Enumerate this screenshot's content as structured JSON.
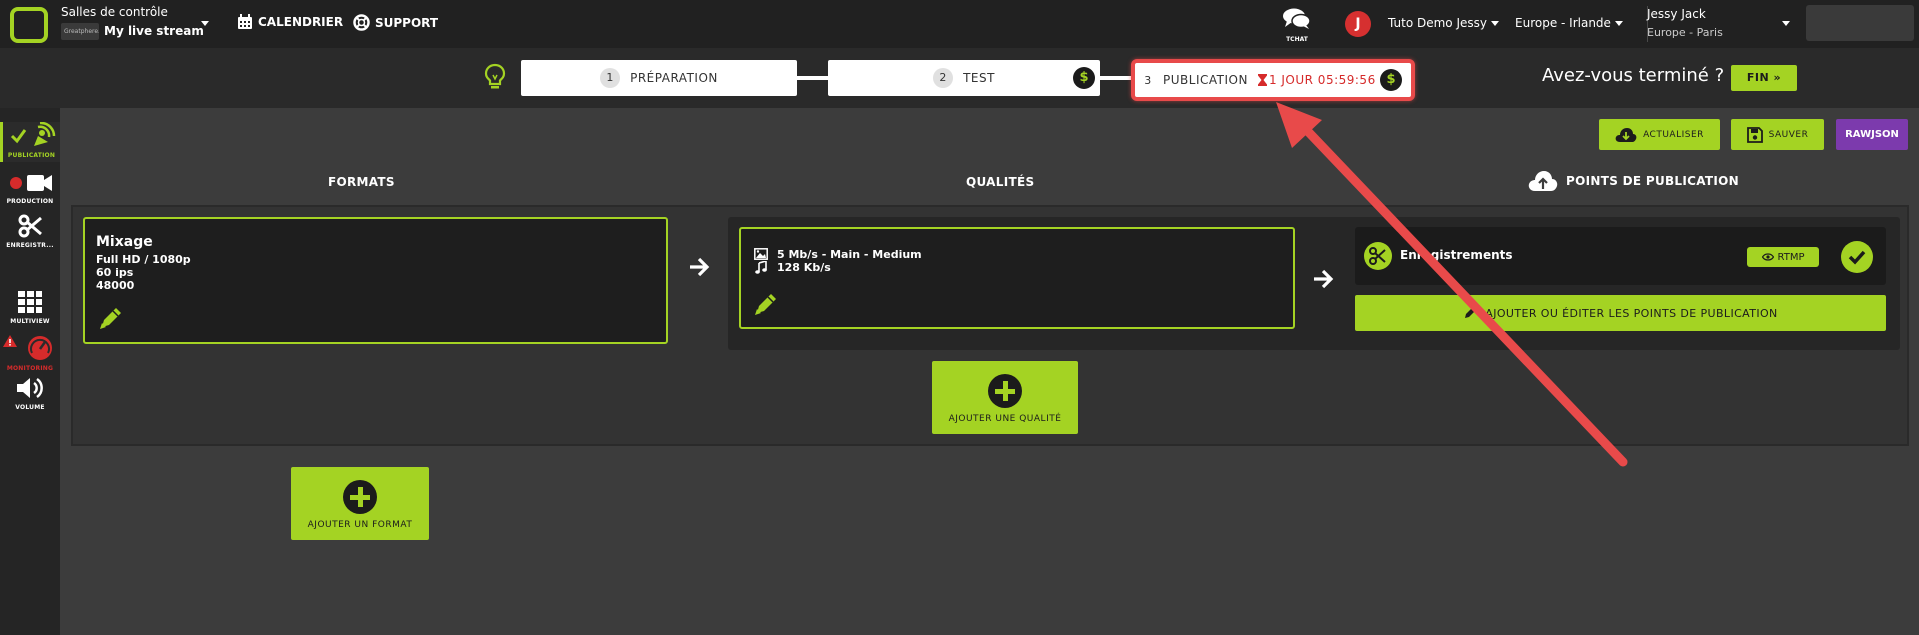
{
  "topbar": {
    "rooms_label": "Salles de contrôle",
    "stream_badge": "Greatphere.tv",
    "stream_name": "My live stream",
    "calendar_label": "CALENDRIER",
    "support_label": "SUPPORT",
    "tchat_label": "TCHAT",
    "avatar_letter": "J",
    "account": "Tuto Demo Jessy",
    "region": "Europe - Irlande",
    "user_name": "Jessy Jack",
    "user_timezone": "Europe - Paris"
  },
  "stepper": {
    "steps": [
      {
        "num": "1",
        "label": "PRÉPARATION"
      },
      {
        "num": "2",
        "label": "TEST"
      },
      {
        "num": "3",
        "label": "PUBLICATION"
      }
    ],
    "dollar": "$",
    "timer": "1 JOUR 05:59:56",
    "done_question": "Avez-vous terminé ?",
    "fin_label": "FIN"
  },
  "sidebar": {
    "publication": "PUBLICATION",
    "production": "PRODUCTION",
    "enregistrement": "ENREGISTR...",
    "multiview": "MULTIVIEW",
    "monitoring": "MONITORING",
    "volume": "VOLUME"
  },
  "actions": {
    "actualiser": "ACTUALISER",
    "sauver": "SAUVER",
    "rawjson": "RAWJSON"
  },
  "columns": {
    "formats": "FORMATS",
    "qualites": "QUALITÉS",
    "points": "POINTS DE PUBLICATION"
  },
  "format": {
    "title": "Mixage",
    "resolution": "Full HD / 1080p",
    "fps": "60 ips",
    "audio_rate": "48000"
  },
  "quality": {
    "video": "5 Mb/s  -  Main  -  Medium",
    "audio": "128 Kb/s"
  },
  "publication_point": {
    "name": "Enregistrements",
    "protocol": "RTMP"
  },
  "buttons": {
    "add_edit_points": "AJOUTER OU ÉDITER LES POINTS DE PUBLICATION",
    "add_quality": "AJOUTER UNE QUALITÉ",
    "add_format": "AJOUTER UN FORMAT"
  },
  "colors": {
    "accent": "#a4d323",
    "danger": "#d62b2b",
    "purple": "#7c3aad",
    "annotation": "#e84a4a"
  }
}
